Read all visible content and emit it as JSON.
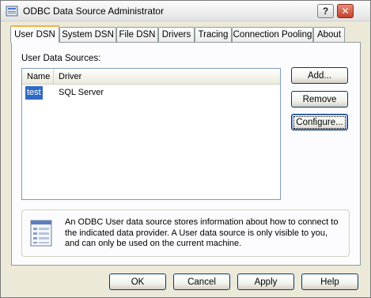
{
  "window": {
    "title": "ODBC Data Source Administrator",
    "help_label": "?",
    "close_label": "✕"
  },
  "tabs": [
    {
      "label": "User DSN"
    },
    {
      "label": "System DSN"
    },
    {
      "label": "File DSN"
    },
    {
      "label": "Drivers"
    },
    {
      "label": "Tracing"
    },
    {
      "label": "Connection Pooling"
    },
    {
      "label": "About"
    }
  ],
  "panel": {
    "group_label": "User Data Sources:",
    "columns": [
      "Name",
      "Driver"
    ],
    "rows": [
      {
        "name": "test",
        "driver": "SQL Server"
      }
    ],
    "buttons": {
      "add": "Add...",
      "remove": "Remove",
      "configure": "Configure..."
    },
    "info_text": "An ODBC User data source stores information about how to connect to the indicated data provider.   A User data source is only visible to you, and can only be used on the current machine."
  },
  "footer": {
    "ok": "OK",
    "cancel": "Cancel",
    "apply": "Apply",
    "help": "Help"
  }
}
